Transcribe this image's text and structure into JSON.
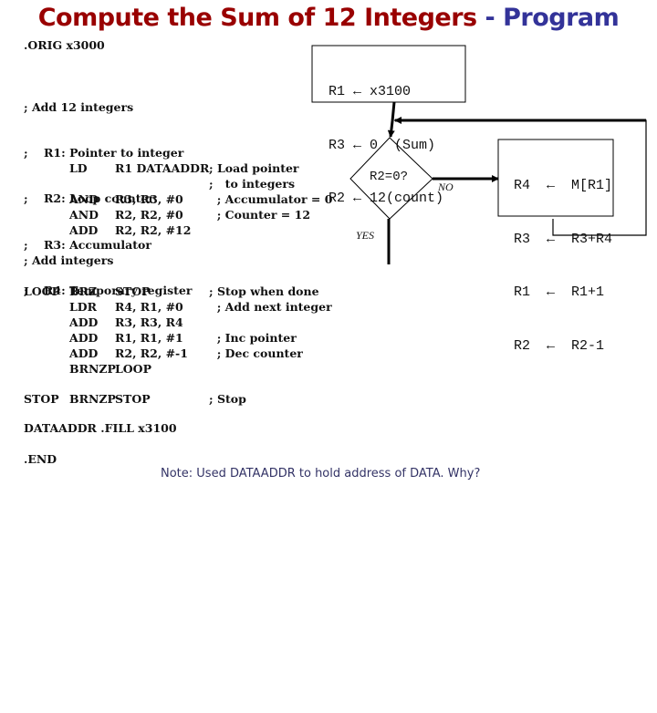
{
  "title": {
    "part1": "Compute the Sum of 12 Integers",
    "part2": " - Program",
    "color1": "#990000",
    "color2": "#333399"
  },
  "code_header": {
    "orig": ".ORIG x3000",
    "comments": [
      "; Add 12 integers",
      ";    R1: Pointer to integer",
      ";    R2: Loop counter",
      ";    R3: Accumulator",
      ";    R4: Temporary register"
    ]
  },
  "init_code": [
    {
      "op": "LD",
      "args": "R1 DATAADDR",
      "comment": "; Load pointer"
    },
    {
      "op": "",
      "args": "",
      "comment": ";   to integers"
    },
    {
      "op": "AND",
      "args": "R3, R3, #0",
      "comment": "  ; Accumulator = 0"
    },
    {
      "op": "AND",
      "args": "R2, R2, #0",
      "comment": "  ; Counter = 12"
    },
    {
      "op": "ADD",
      "args": "R2, R2, #12",
      "comment": ""
    }
  ],
  "loop_header": "; Add integers",
  "loop_code": [
    {
      "label": "LOOP",
      "op": "BRZ",
      "args": "STOP",
      "comment": "; Stop when done"
    },
    {
      "label": "",
      "op": "LDR",
      "args": "R4, R1, #0",
      "comment": "  ; Add next integer"
    },
    {
      "label": "",
      "op": "ADD",
      "args": "R3, R3, R4",
      "comment": ""
    },
    {
      "label": "",
      "op": "ADD",
      "args": "R1, R1, #1",
      "comment": "  ; Inc pointer"
    },
    {
      "label": "",
      "op": "ADD",
      "args": "R2, R2, #-1",
      "comment": "  ; Dec counter"
    },
    {
      "label": "",
      "op": "BRNZP",
      "args": "LOOP",
      "comment": ""
    }
  ],
  "stop_line": {
    "label": "STOP",
    "op": "BRNZP",
    "args": "STOP",
    "comment": "; Stop"
  },
  "data_line": "DATAADDR .FILL x3100",
  "end_line": ".END",
  "flowchart": {
    "init_box": [
      "R1 ← x3100",
      "R3 ← 0  (Sum)",
      "R2 ← 12(count)"
    ],
    "decision": "R2=0?",
    "no_label": "NO",
    "yes_label": "YES",
    "loop_box": [
      "R4  ←  M[R1]",
      "R3  ←  R3+R4",
      "R1  ←  R1+1",
      "R2  ←  R2-1"
    ]
  },
  "note": "Note: Used DATAADDR to hold address of DATA.  Why?"
}
